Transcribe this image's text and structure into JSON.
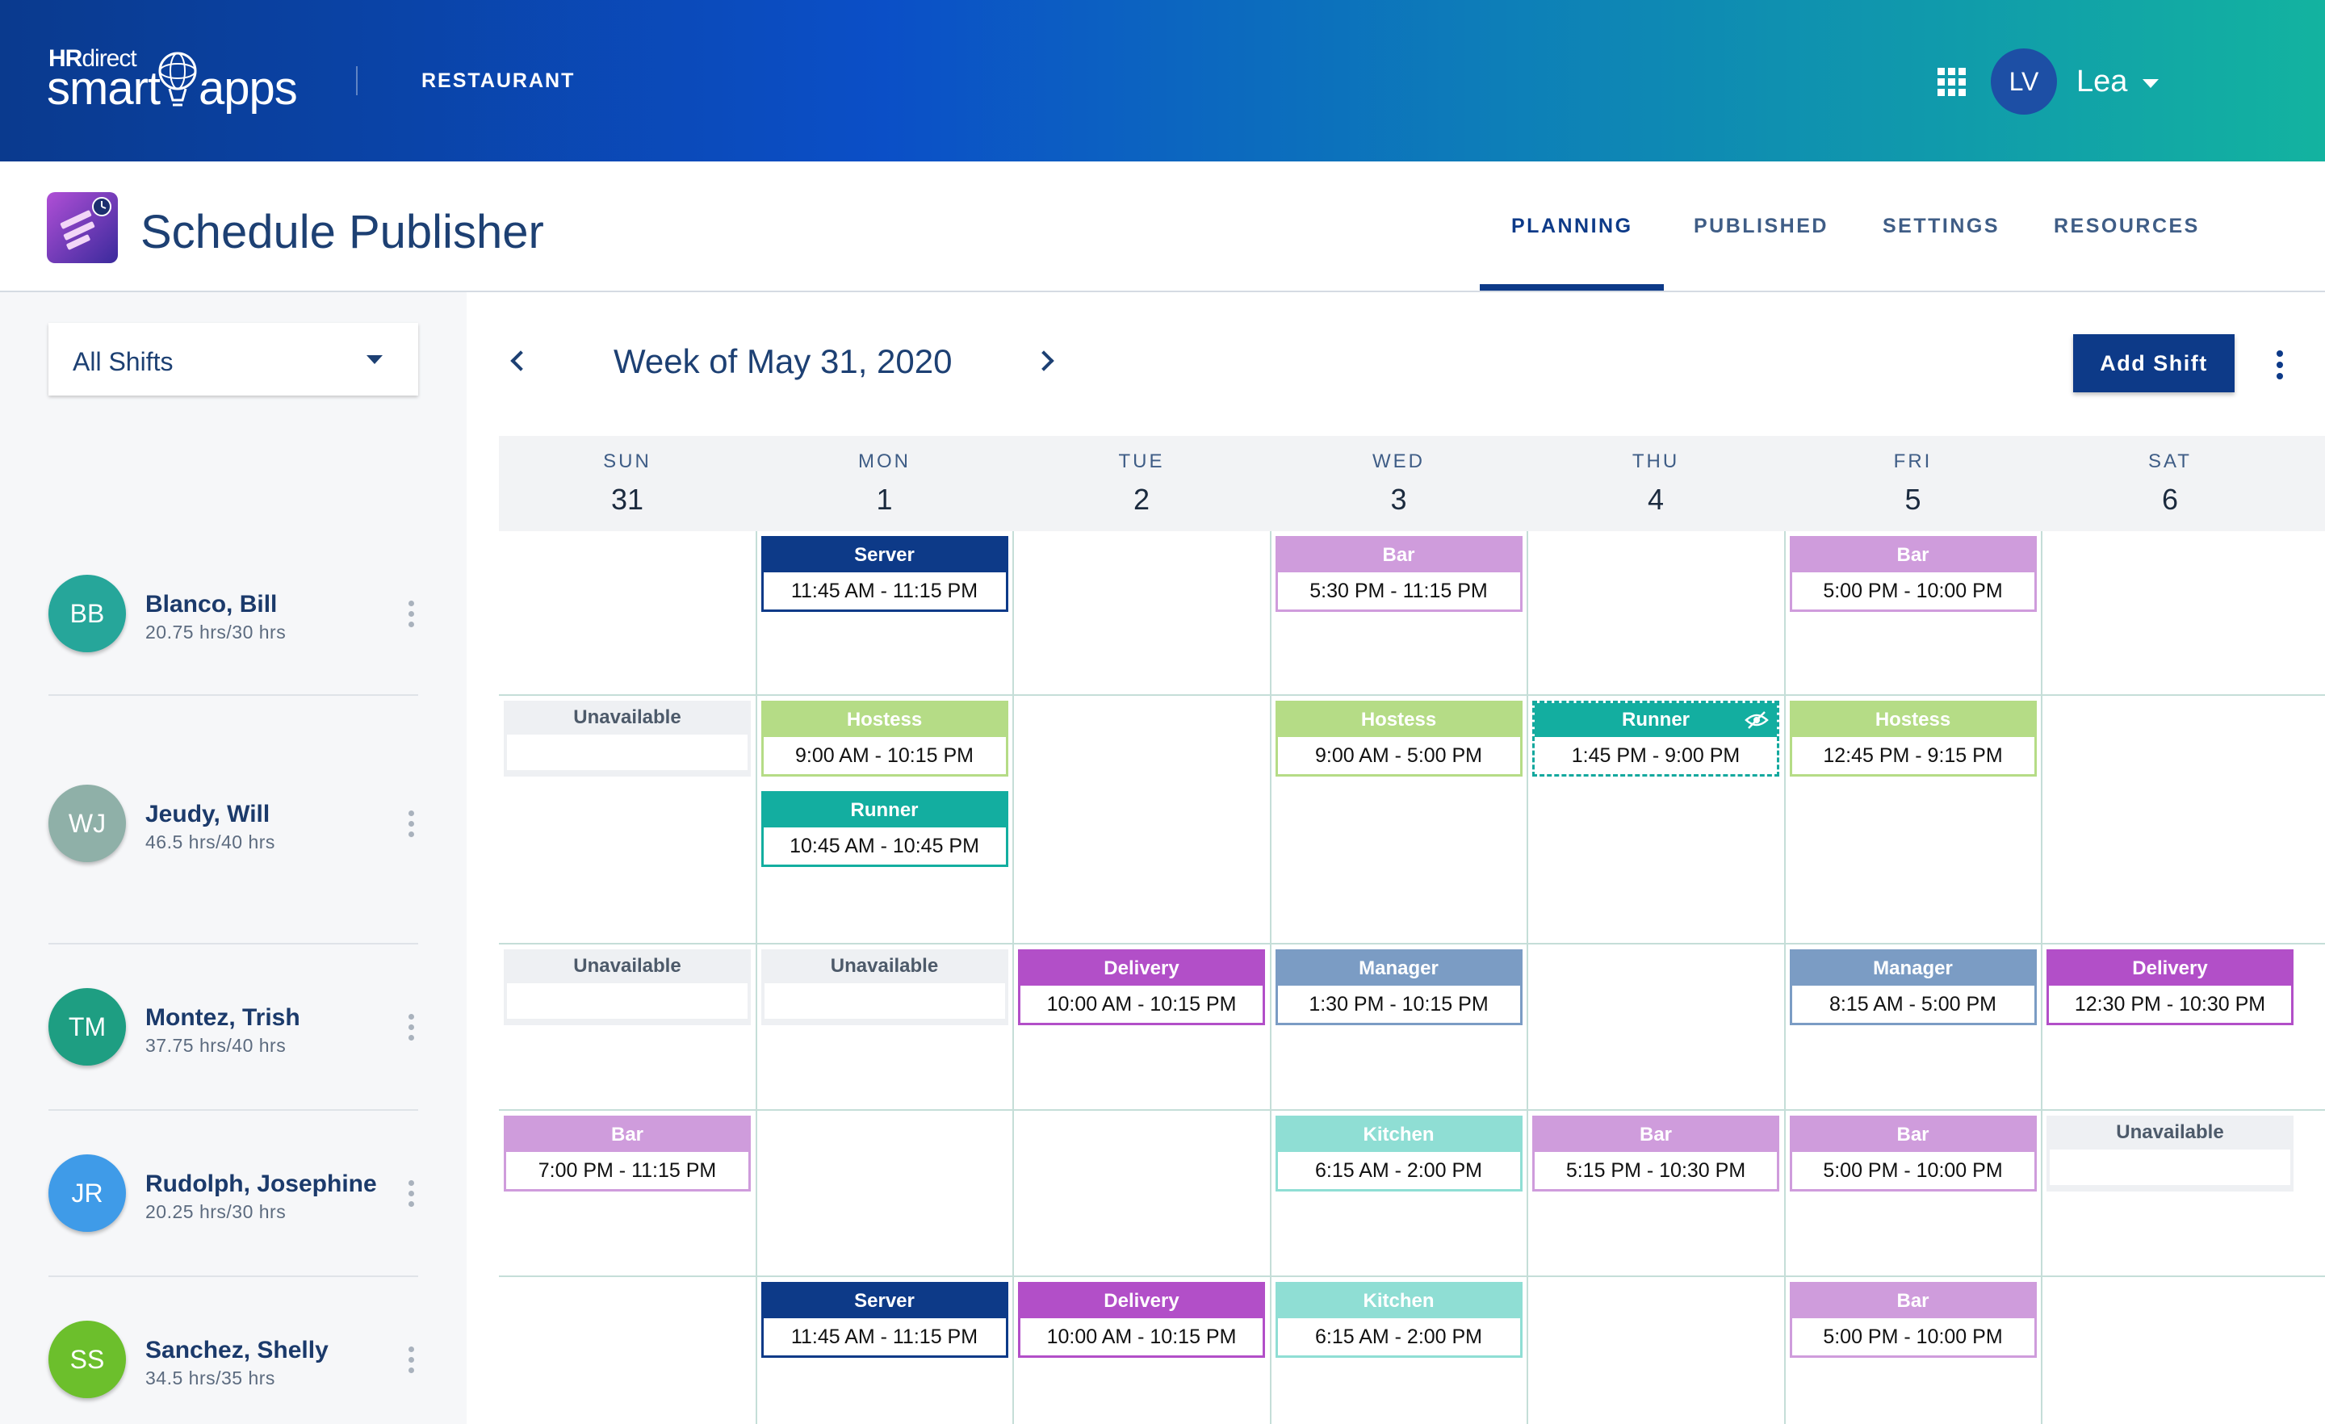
{
  "brand": {
    "hr_bold": "HR",
    "hr_light": "direct",
    "smart": "smart",
    "apps": "apps"
  },
  "org": "RESTAURANT",
  "user": {
    "initials": "LV",
    "name": "Lea"
  },
  "app": {
    "title": "Schedule Publisher"
  },
  "tabs": [
    {
      "label": "PLANNING",
      "active": true
    },
    {
      "label": "PUBLISHED",
      "active": false
    },
    {
      "label": "SETTINGS",
      "active": false
    },
    {
      "label": "RESOURCES",
      "active": false
    }
  ],
  "filter": {
    "selected": "All Shifts"
  },
  "week": {
    "title": "Week of May 31, 2020",
    "add_shift_label": "Add Shift"
  },
  "days": [
    {
      "name": "SUN",
      "num": "31"
    },
    {
      "name": "MON",
      "num": "1"
    },
    {
      "name": "TUE",
      "num": "2"
    },
    {
      "name": "WED",
      "num": "3"
    },
    {
      "name": "THU",
      "num": "4"
    },
    {
      "name": "FRI",
      "num": "5"
    },
    {
      "name": "SAT",
      "num": "6"
    }
  ],
  "employees": [
    {
      "initials": "BB",
      "name": "Blanco, Bill",
      "hours": "20.75 hrs/30 hrs",
      "color": "#26a69a"
    },
    {
      "initials": "WJ",
      "name": "Jeudy, Will",
      "hours": "46.5 hrs/40 hrs",
      "color": "#8fb0a8"
    },
    {
      "initials": "TM",
      "name": "Montez, Trish",
      "hours": "37.75 hrs/40 hrs",
      "color": "#1e9e82"
    },
    {
      "initials": "JR",
      "name": "Rudolph, Josephine",
      "hours": "20.25 hrs/30 hrs",
      "color": "#3f9be8"
    },
    {
      "initials": "SS",
      "name": "Sanchez, Shelly",
      "hours": "34.5 hrs/35 hrs",
      "color": "#6cbf2c"
    }
  ],
  "role_colors": {
    "Server": "#0d3a88",
    "Bar": "#cf9cdc",
    "Hostess": "#b5dc86",
    "Runner": "#13aea0",
    "Delivery": "#b24fc8",
    "Manager": "#7b9cc4",
    "Kitchen": "#8fded4",
    "Unavailable": "#eef0f3"
  },
  "shifts": [
    {
      "emp": 0,
      "day": 1,
      "slot": 0,
      "role": "Server",
      "time": "11:45 AM - 11:15 PM"
    },
    {
      "emp": 0,
      "day": 3,
      "slot": 0,
      "role": "Bar",
      "time": "5:30 PM - 11:15 PM"
    },
    {
      "emp": 0,
      "day": 5,
      "slot": 0,
      "role": "Bar",
      "time": "5:00 PM - 10:00 PM"
    },
    {
      "emp": 1,
      "day": 0,
      "slot": 0,
      "role": "Unavailable",
      "time": ""
    },
    {
      "emp": 1,
      "day": 1,
      "slot": 0,
      "role": "Hostess",
      "time": "9:00 AM - 10:15 PM"
    },
    {
      "emp": 1,
      "day": 1,
      "slot": 1,
      "role": "Runner",
      "time": "10:45 AM - 10:45 PM"
    },
    {
      "emp": 1,
      "day": 3,
      "slot": 0,
      "role": "Hostess",
      "time": "9:00 AM - 5:00 PM"
    },
    {
      "emp": 1,
      "day": 4,
      "slot": 0,
      "role": "Runner",
      "time": "1:45 PM - 9:00 PM",
      "hidden": true
    },
    {
      "emp": 1,
      "day": 5,
      "slot": 0,
      "role": "Hostess",
      "time": "12:45 PM - 9:15 PM"
    },
    {
      "emp": 2,
      "day": 0,
      "slot": 0,
      "role": "Unavailable",
      "time": ""
    },
    {
      "emp": 2,
      "day": 1,
      "slot": 0,
      "role": "Unavailable",
      "time": ""
    },
    {
      "emp": 2,
      "day": 2,
      "slot": 0,
      "role": "Delivery",
      "time": "10:00 AM - 10:15 PM"
    },
    {
      "emp": 2,
      "day": 3,
      "slot": 0,
      "role": "Manager",
      "time": "1:30 PM - 10:15 PM"
    },
    {
      "emp": 2,
      "day": 5,
      "slot": 0,
      "role": "Manager",
      "time": "8:15 AM - 5:00 PM"
    },
    {
      "emp": 2,
      "day": 6,
      "slot": 0,
      "role": "Delivery",
      "time": "12:30 PM - 10:30 PM"
    },
    {
      "emp": 3,
      "day": 0,
      "slot": 0,
      "role": "Bar",
      "time": "7:00 PM - 11:15 PM"
    },
    {
      "emp": 3,
      "day": 3,
      "slot": 0,
      "role": "Kitchen",
      "time": "6:15 AM - 2:00 PM"
    },
    {
      "emp": 3,
      "day": 4,
      "slot": 0,
      "role": "Bar",
      "time": "5:15 PM - 10:30 PM"
    },
    {
      "emp": 3,
      "day": 5,
      "slot": 0,
      "role": "Bar",
      "time": "5:00 PM - 10:00 PM"
    },
    {
      "emp": 3,
      "day": 6,
      "slot": 0,
      "role": "Unavailable",
      "time": ""
    },
    {
      "emp": 4,
      "day": 1,
      "slot": 0,
      "role": "Server",
      "time": "11:45 AM - 11:15 PM"
    },
    {
      "emp": 4,
      "day": 2,
      "slot": 0,
      "role": "Delivery",
      "time": "10:00 AM - 10:15 PM"
    },
    {
      "emp": 4,
      "day": 3,
      "slot": 0,
      "role": "Kitchen",
      "time": "6:15 AM - 2:00 PM"
    },
    {
      "emp": 4,
      "day": 5,
      "slot": 0,
      "role": "Bar",
      "time": "5:00 PM - 10:00 PM"
    }
  ]
}
